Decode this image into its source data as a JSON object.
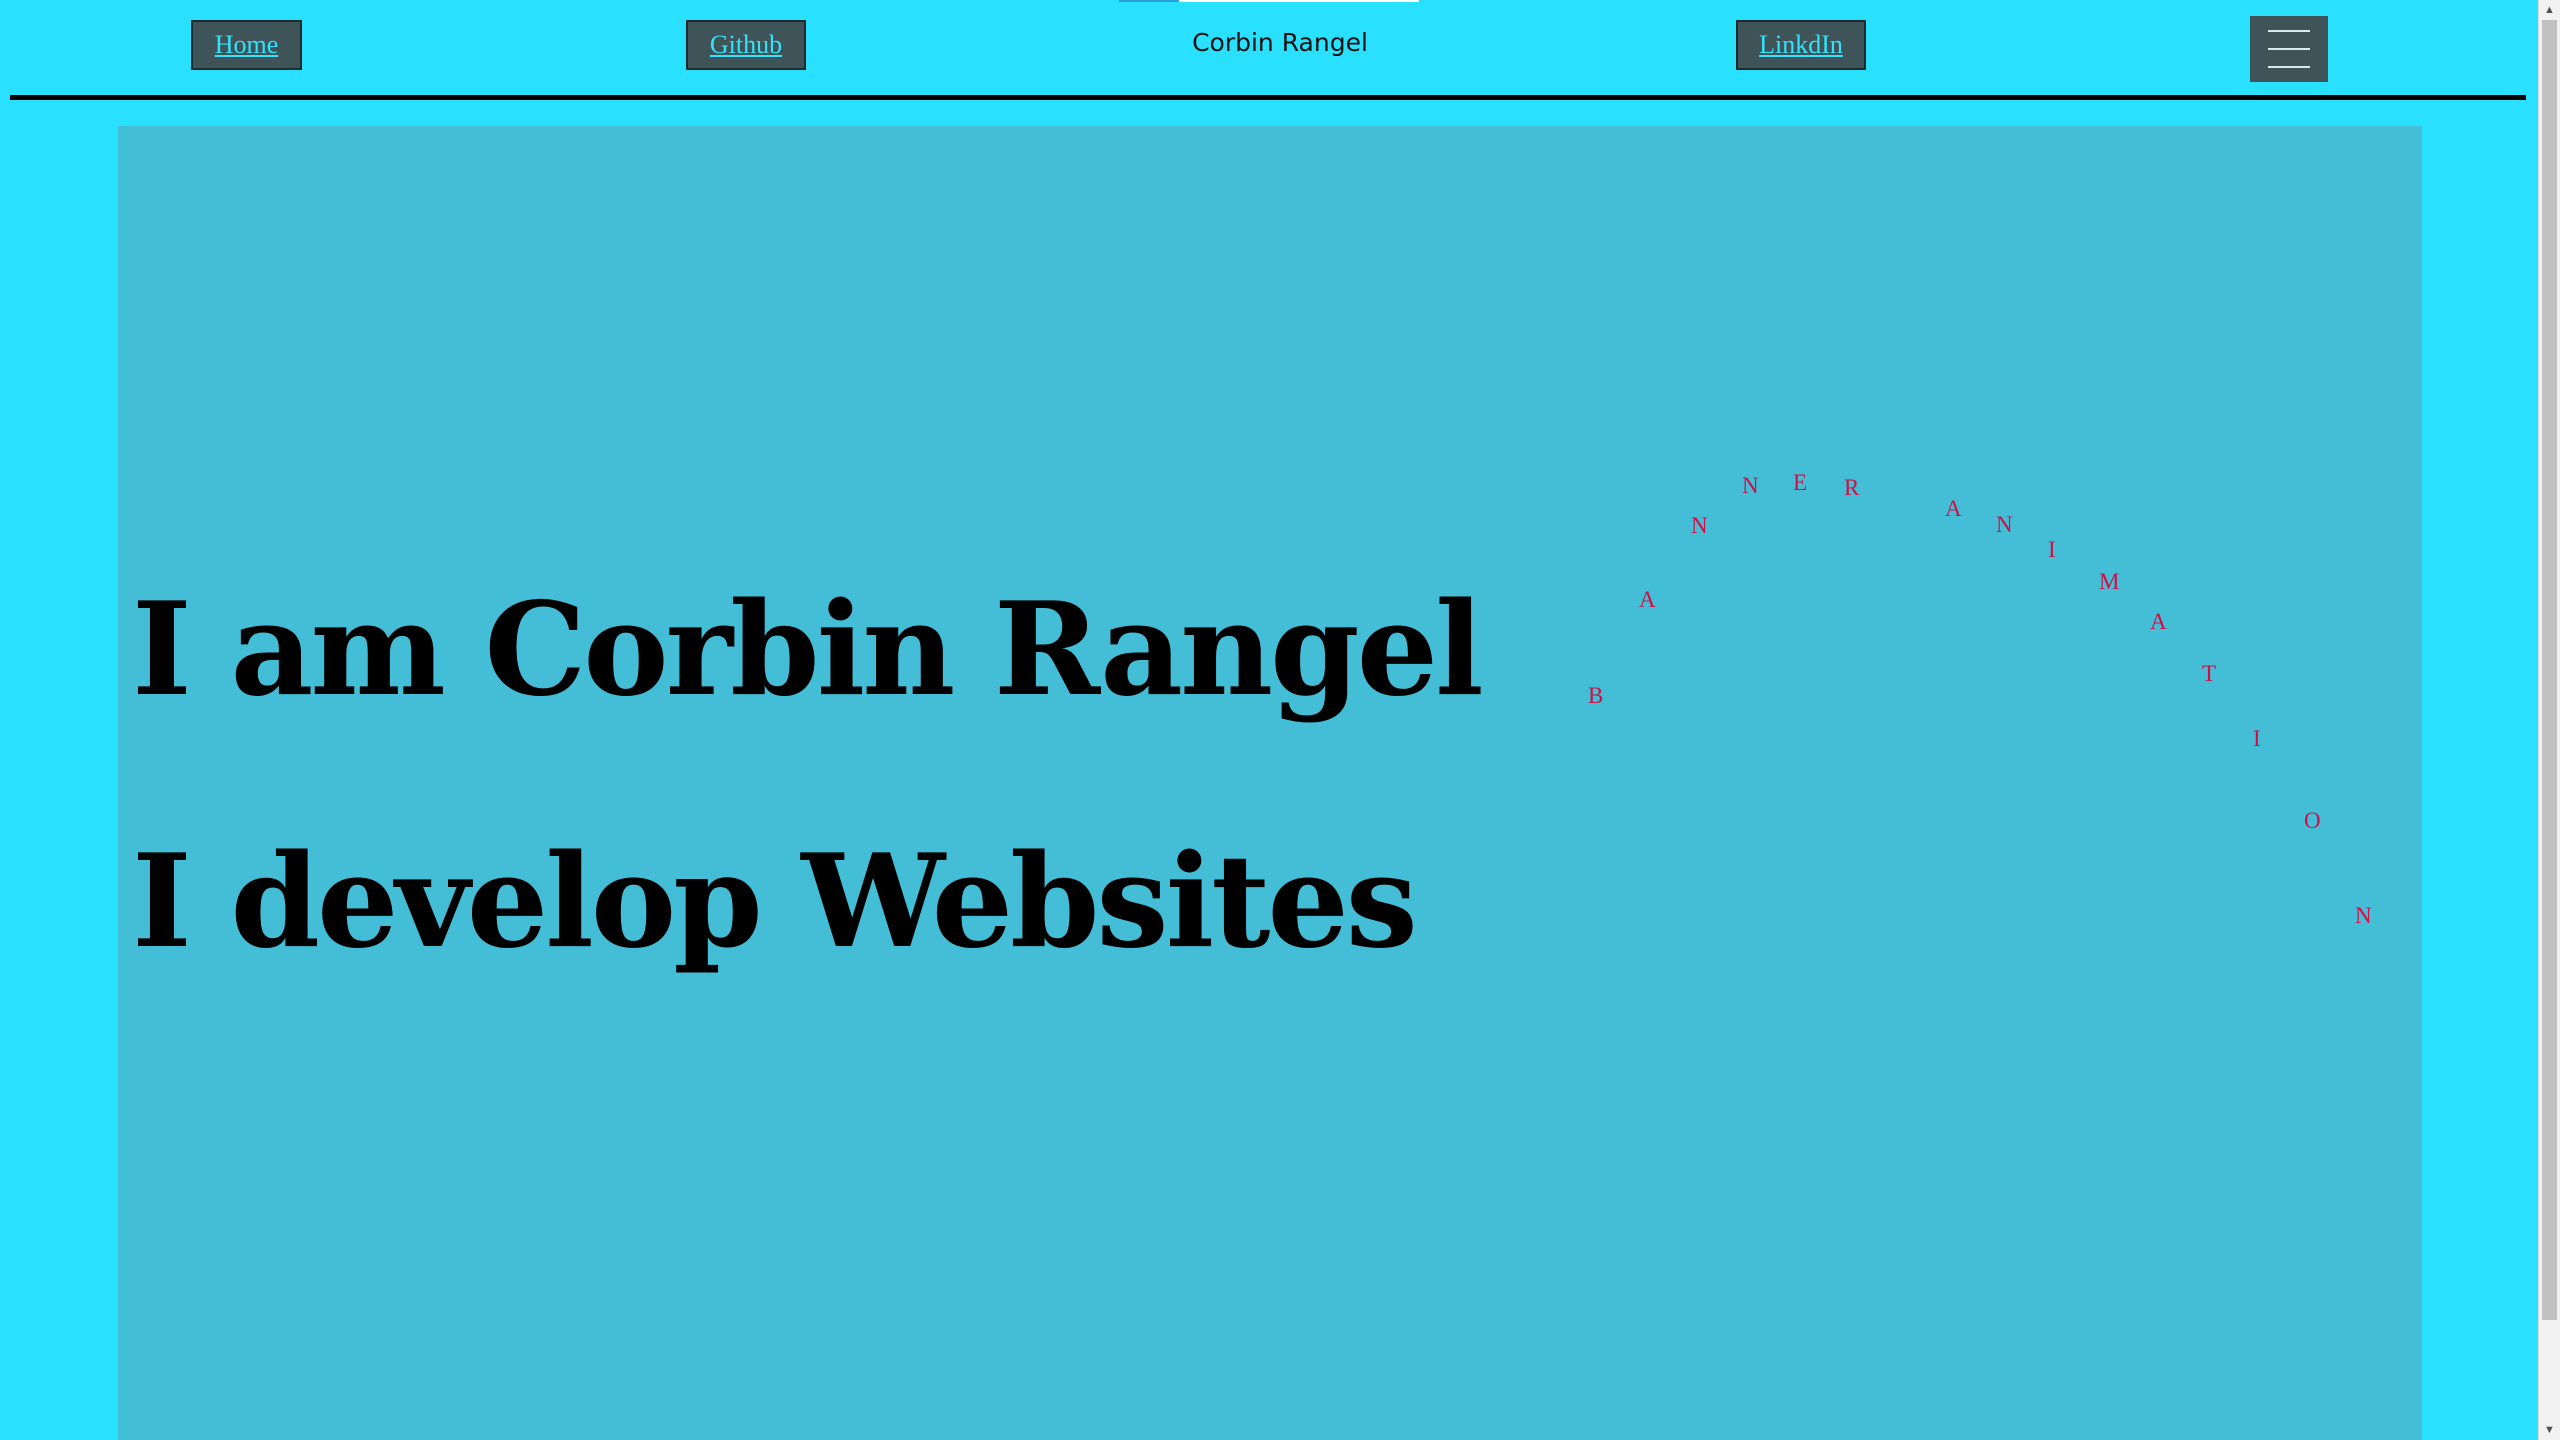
{
  "nav": {
    "home_label": "Home",
    "github_label": "Github",
    "brand": "Corbin Rangel",
    "linkedin_label": "LinkdIn",
    "menu_icon": "hamburger-menu-icon"
  },
  "hero": {
    "line1": "I am Corbin Rangel",
    "line2": "I develop Websites",
    "banner_letters": [
      "B",
      "A",
      "N",
      "N",
      "E",
      "R",
      "A",
      "N",
      "I",
      "M",
      "A",
      "T",
      "I",
      "O",
      "N"
    ]
  },
  "colors": {
    "page_background": "#29e0fe",
    "hero_background": "#43bed6",
    "nav_button_background": "#3f5459",
    "nav_link_color": "#33e3fb",
    "banner_letter_color": "#d10f45"
  },
  "scrollbar": {
    "up_icon": "scroll-up-arrow-icon",
    "down_icon": "scroll-down-arrow-icon"
  }
}
